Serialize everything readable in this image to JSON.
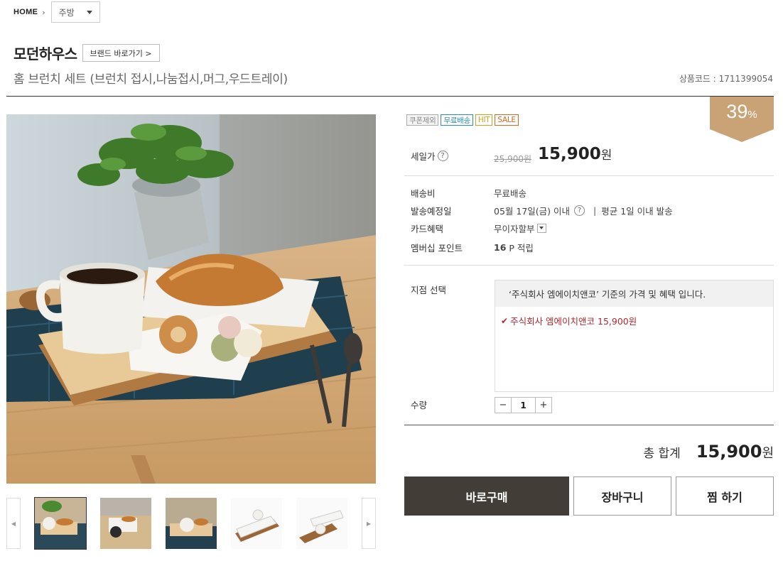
{
  "breadcrumb": {
    "home": "HOME",
    "category": "주방"
  },
  "brand": {
    "name": "모던하우스",
    "link_label": "브랜드 바로가기 >"
  },
  "product": {
    "title": "홈 브런치 세트 (브런치 접시,나눔접시,머그,우드트레이)",
    "code": "상품코드 : 1711399054"
  },
  "badges": [
    {
      "label": "쿠폰제외",
      "color": "#888888"
    },
    {
      "label": "무료배송",
      "color": "#2a8fb5"
    },
    {
      "label": "HIT",
      "color": "#d4a21a"
    },
    {
      "label": "SALE",
      "color": "#d2691e"
    }
  ],
  "discount": {
    "value": "39",
    "unit": "%",
    "color": "#c9a276"
  },
  "price": {
    "label": "세일가",
    "help": "?",
    "original": "25,900원",
    "sale": "15,900",
    "unit": "원"
  },
  "shipping": {
    "label": "배송비",
    "value": "무료배송"
  },
  "delivery": {
    "label": "발송예정일",
    "date": "05월 17일(금) 이내",
    "help": "?",
    "avg": "평균 1일 이내 발송",
    "sep": "|"
  },
  "card": {
    "label": "카드혜택",
    "value": "무이자할부"
  },
  "points": {
    "label": "멤버십 포인트",
    "value": "16",
    "unit": "P 적립"
  },
  "branch": {
    "label": "지점 선택",
    "notice": "‘주식회사 엠에이치앤코’ 기준의 가격 및 혜택 입니다.",
    "selected": "주식회사 엠에이치앤코 15,900원"
  },
  "quantity": {
    "label": "수량",
    "minus": "−",
    "value": "1",
    "plus": "+"
  },
  "total": {
    "label": "총 합계",
    "amount": "15,900",
    "unit": "원"
  },
  "buttons": {
    "buy": "바로구매",
    "cart": "장바구니",
    "wish": "찜 하기"
  },
  "thumbnails": {
    "prev": "◀",
    "next": "▶",
    "count": 5,
    "active_index": 0
  },
  "colors": {
    "accent_dark": "#423e37",
    "branch_red": "#b0282d"
  }
}
